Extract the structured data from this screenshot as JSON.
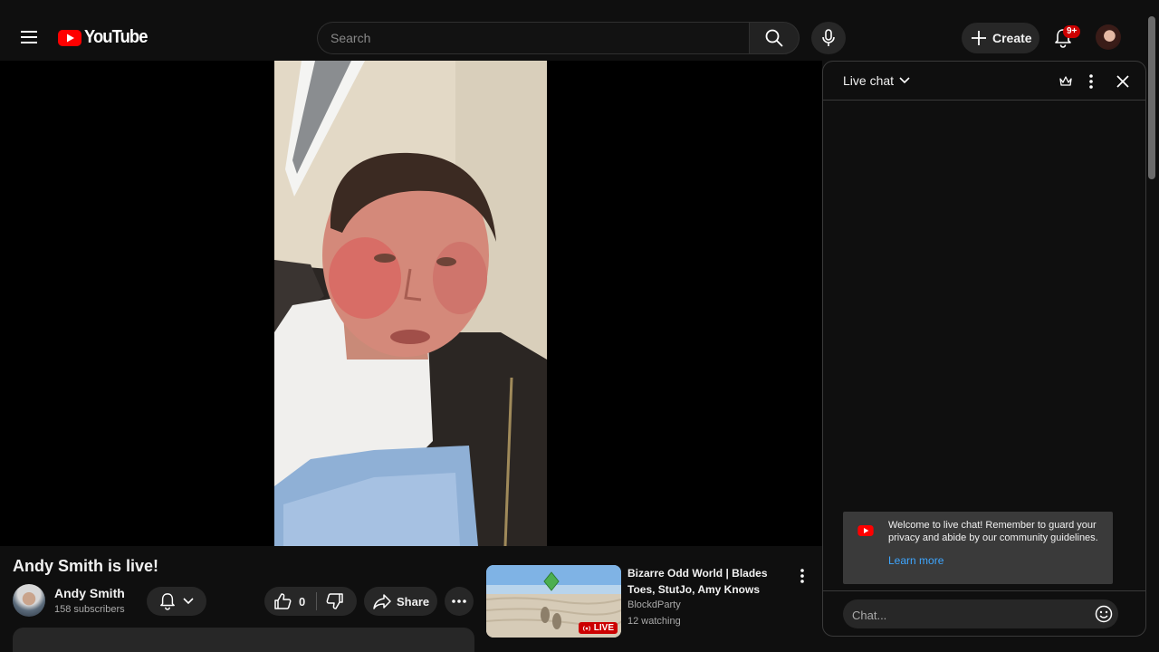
{
  "masthead": {
    "logo_text": "YouTube",
    "search_placeholder": "Search",
    "create_label": "Create",
    "notification_badge": "9+"
  },
  "video": {
    "title": "Andy Smith is live!",
    "channel_name": "Andy Smith",
    "subscribers": "158 subscribers",
    "like_count": "0",
    "share_label": "Share"
  },
  "recommended": {
    "title": "Bizarre Odd World | Blades Toes, StutJo, Amy Knows",
    "channel": "BlockdParty",
    "watching": "12 watching",
    "live_label": "LIVE"
  },
  "chat": {
    "mode_label": "Live chat",
    "welcome_message": "Welcome to live chat! Remember to guard your privacy and abide by our community guidelines.",
    "learn_more": "Learn more",
    "input_placeholder": "Chat..."
  },
  "colors": {
    "background": "#0f0f0f",
    "brand_red": "#ff0000",
    "live_red": "#cc0000",
    "link_blue": "#3ea6ff",
    "pill_bg": "#272727"
  },
  "icons": [
    "menu-icon",
    "youtube-logo-icon",
    "search-icon",
    "mic-icon",
    "plus-icon",
    "bell-icon",
    "thumb-up-icon",
    "thumb-down-icon",
    "share-arrow-icon",
    "more-horiz-icon",
    "more-vert-icon",
    "chevron-down-icon",
    "crown-icon",
    "close-icon",
    "emoji-icon",
    "live-broadcast-icon"
  ]
}
